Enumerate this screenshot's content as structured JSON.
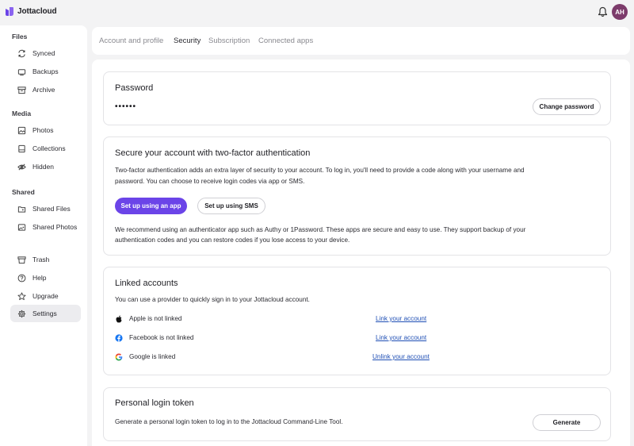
{
  "app": {
    "name": "Jottacloud",
    "avatar_initials": "AH",
    "accent": "#6b44e8",
    "avatar_color": "#7c3b6b"
  },
  "sidebar": {
    "sections": [
      {
        "label": "Files",
        "items": [
          {
            "label": "Synced",
            "icon": "sync-icon"
          },
          {
            "label": "Backups",
            "icon": "backup-icon"
          },
          {
            "label": "Archive",
            "icon": "archive-icon"
          }
        ]
      },
      {
        "label": "Media",
        "items": [
          {
            "label": "Photos",
            "icon": "photo-icon"
          },
          {
            "label": "Collections",
            "icon": "collection-icon"
          },
          {
            "label": "Hidden",
            "icon": "hidden-icon"
          }
        ]
      },
      {
        "label": "Shared",
        "items": [
          {
            "label": "Shared Files",
            "icon": "folder-shared-icon"
          },
          {
            "label": "Shared Photos",
            "icon": "photo-shared-icon"
          }
        ]
      }
    ],
    "bottom_items": [
      {
        "label": "Trash",
        "icon": "trash-icon"
      },
      {
        "label": "Help",
        "icon": "help-icon"
      },
      {
        "label": "Upgrade",
        "icon": "star-icon"
      },
      {
        "label": "Settings",
        "icon": "gear-icon",
        "active": true
      }
    ]
  },
  "tabs": [
    {
      "label": "Account and profile"
    },
    {
      "label": "Security",
      "active": true
    },
    {
      "label": "Subscription"
    },
    {
      "label": "Connected apps"
    }
  ],
  "password": {
    "title": "Password",
    "masked": "••••••",
    "button": "Change password"
  },
  "two_factor": {
    "title": "Secure your account with two-factor authentication",
    "description_line1": "Two-factor authentication adds an extra layer of security to your account. To log in, you'll need to provide a code along with your username and",
    "description_line2": "password. You can choose to receive login codes via app or SMS.",
    "app_button": "Set up using an app",
    "sms_button": "Set up using SMS",
    "note_line1": "We recommend using an authenticator app such as Authy or 1Password. These apps are secure and easy to use. They support backup of your",
    "note_line2": "authentication codes and you can restore codes if you lose access to your device."
  },
  "linked_accounts": {
    "title": "Linked accounts",
    "description": "You can use a provider to quickly sign in to your Jottacloud account.",
    "providers": [
      {
        "label": "Apple is not linked",
        "action": "Link your account",
        "icon": "apple-icon"
      },
      {
        "label": "Facebook is not linked",
        "action": "Link your account",
        "icon": "facebook-icon"
      },
      {
        "label": "Google is linked",
        "action": "Unlink your account",
        "icon": "google-icon"
      }
    ]
  },
  "login_token": {
    "title": "Personal login token",
    "description": "Generate a personal login token to log in to the Jottacloud Command-Line Tool.",
    "button": "Generate"
  }
}
